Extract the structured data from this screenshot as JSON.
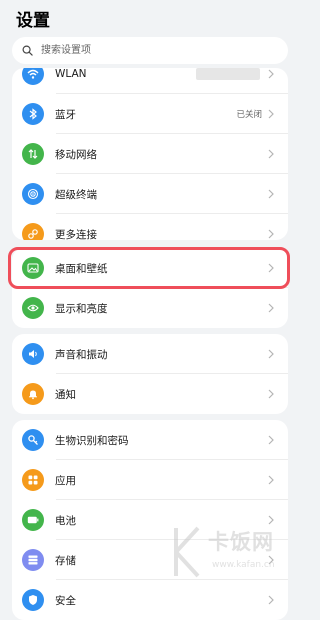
{
  "header": {
    "title": "设置"
  },
  "search": {
    "placeholder": "搜索设置项"
  },
  "group1": [
    {
      "label": "WLAN",
      "icon": "wifi-icon",
      "color": "#2f8ff0"
    },
    {
      "label": "蓝牙",
      "value": "已关闭",
      "icon": "bluetooth-icon",
      "color": "#2f8ff0"
    },
    {
      "label": "移动网络",
      "icon": "mobile-network-icon",
      "color": "#43b54b"
    },
    {
      "label": "超级终端",
      "icon": "super-device-icon",
      "color": "#2f8ff0"
    },
    {
      "label": "更多连接",
      "icon": "link-icon",
      "color": "#f59a1b"
    }
  ],
  "group2": [
    {
      "label": "桌面和壁纸",
      "icon": "wallpaper-icon",
      "color": "#43b54b"
    },
    {
      "label": "显示和亮度",
      "icon": "eye-icon",
      "color": "#43b54b"
    }
  ],
  "group3": [
    {
      "label": "声音和振动",
      "icon": "sound-icon",
      "color": "#2f8ff0"
    },
    {
      "label": "通知",
      "icon": "bell-icon",
      "color": "#f59a1b"
    }
  ],
  "group4": [
    {
      "label": "生物识别和密码",
      "icon": "key-icon",
      "color": "#2f8ff0"
    },
    {
      "label": "应用",
      "icon": "apps-icon",
      "color": "#f59a1b"
    },
    {
      "label": "电池",
      "icon": "battery-icon",
      "color": "#43b54b"
    },
    {
      "label": "存储",
      "icon": "storage-icon",
      "color": "#7f8cf0"
    },
    {
      "label": "安全",
      "icon": "shield-icon",
      "color": "#2f8ff0"
    }
  ],
  "watermark": {
    "name": "卡饭网",
    "url": "www.kafan.cn"
  },
  "colors": {
    "highlight": "#ef4e5a",
    "background": "#f1f3f5"
  }
}
